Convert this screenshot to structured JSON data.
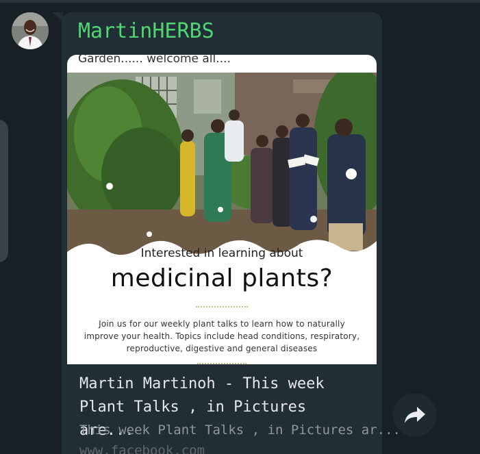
{
  "message": {
    "sender_name": "MartinHERBS",
    "avatar_alt": "sender-avatar",
    "colors": {
      "sender": "#4fd671",
      "bubble": "#222e35",
      "background": "#182026"
    }
  },
  "preview_image": {
    "caption_top": "Garden...... welcome all....",
    "headline_small": "Interested in learning about",
    "headline_large": "medicinal plants?",
    "body_lines": [
      "Join us for our weekly plant talks to learn how to naturally",
      "improve your health. Topics include head conditions, respiratory,",
      "reproductive, digestive and general diseases"
    ]
  },
  "link_preview": {
    "title_line1": "Martin Martinoh - This week",
    "title_line2": "Plant Talks , in Pictures are...",
    "description": "This week Plant Talks , in Pictures ar...",
    "domain": "www.facebook.com"
  },
  "actions": {
    "share_icon": "share-forward-icon"
  }
}
